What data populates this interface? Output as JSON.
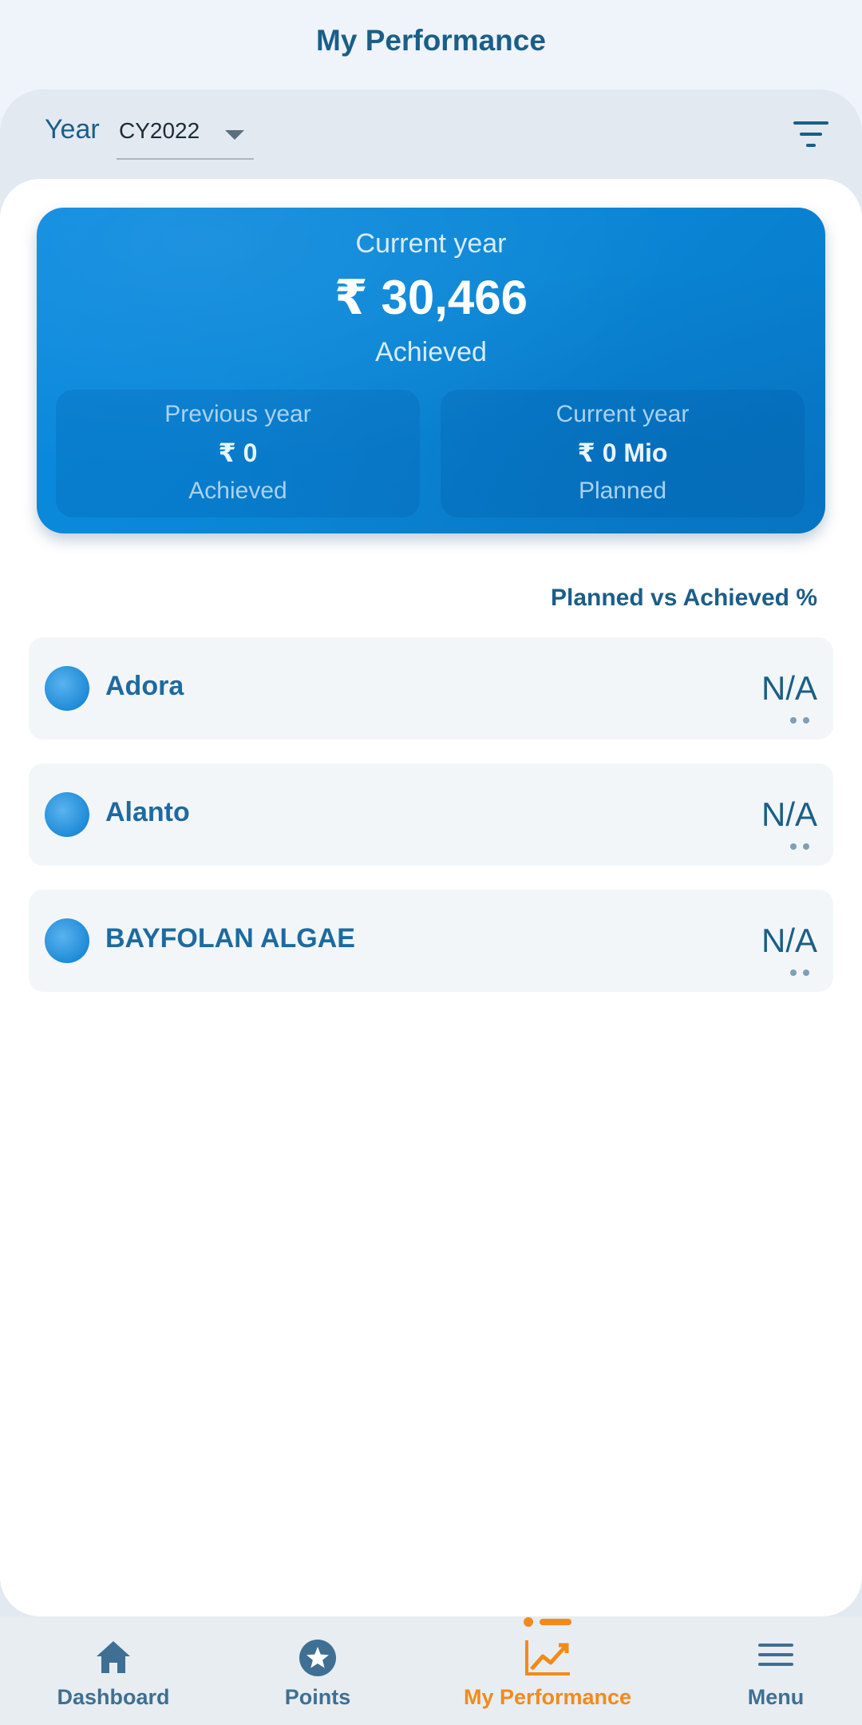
{
  "header": {
    "title": "My Performance"
  },
  "filters": {
    "year_label": "Year",
    "year_value": "CY2022"
  },
  "summary": {
    "current_label": "Current year",
    "current_amount": "₹ 30,466",
    "current_status": "Achieved",
    "previous": {
      "label": "Previous year",
      "amount": "₹ 0",
      "status": "Achieved"
    },
    "planned": {
      "label": "Current year",
      "amount": "₹ 0 Mio",
      "status": "Planned"
    }
  },
  "list": {
    "header": "Planned vs Achieved %",
    "items": [
      {
        "name": "Adora",
        "value": "N/A"
      },
      {
        "name": "Alanto",
        "value": "N/A"
      },
      {
        "name": "BAYFOLAN ALGAE",
        "value": "N/A"
      }
    ]
  },
  "tabs": [
    {
      "label": "Dashboard",
      "icon": "home-icon",
      "active": false
    },
    {
      "label": "Points",
      "icon": "star-badge-icon",
      "active": false
    },
    {
      "label": "My Performance",
      "icon": "trend-chart-icon",
      "active": true
    },
    {
      "label": "Menu",
      "icon": "hamburger-icon",
      "active": false
    }
  ],
  "colors": {
    "accent": "#f28a1a",
    "primary_text": "#1b5e88",
    "hero_blue": "#0a86d6"
  }
}
